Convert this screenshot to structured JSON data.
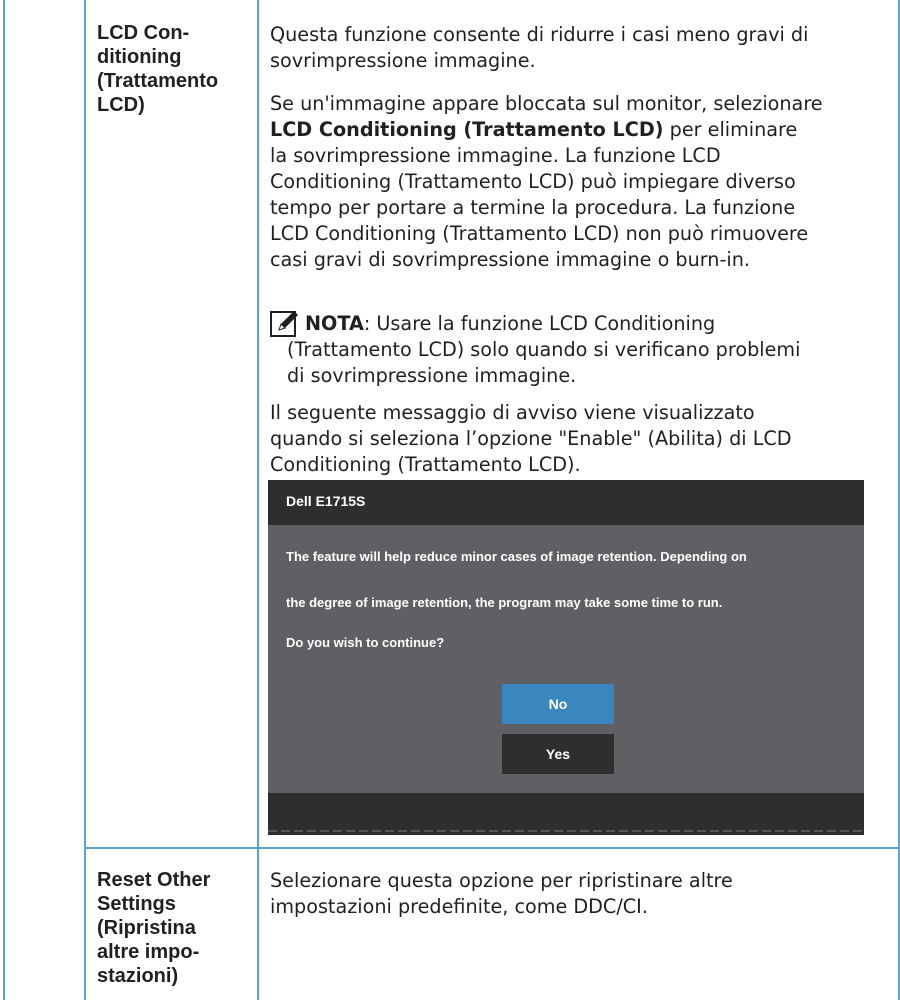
{
  "rows": [
    {
      "label_lines": [
        "LCD Con-",
        "ditioning",
        "(Trattamento",
        "LCD)"
      ],
      "paragraphs": {
        "p1_lines": [
          "Questa funzione consente di ridurre i casi meno gravi di",
          "sovrimpressione immagine."
        ],
        "p2_line1": "Se un'immagine appare bloccata sul monitor, selezionare",
        "p2_bold": "LCD Conditioning (Trattamento LCD)",
        "p2_after_bold": " per eliminare",
        "p2_rest": [
          "la sovrimpressione immagine. La funzione LCD",
          "Conditioning (Trattamento LCD) può impiegare diverso",
          "tempo per portare a termine la procedura. La funzione",
          "LCD Conditioning (Trattamento LCD) non può rimuovere",
          "casi gravi di sovrimpressione immagine o burn-in."
        ],
        "note_label": "NOTA",
        "note_line1": ": Usare la funzione LCD Conditioning",
        "note_rest": [
          "(Trattamento LCD) solo quando si verificano problemi",
          "di sovrimpressione immagine."
        ],
        "p3_lines": [
          "Il seguente messaggio di avviso viene visualizzato",
          "quando si seleziona l’opzione \"Enable\" (Abilita) di LCD",
          "Conditioning (Trattamento LCD)."
        ]
      }
    },
    {
      "label_lines": [
        "Reset Other",
        "Settings",
        "(Ripristina",
        "altre impo-",
        "stazioni)"
      ],
      "desc_lines": [
        "Selezionare questa opzione per ripristinare altre",
        "impostazioni predefinite, come DDC/CI."
      ]
    }
  ],
  "dialog": {
    "title": "Dell E1715S",
    "messages": [
      "The feature will help reduce minor cases of image retention. Depending on",
      "the degree of image retention, the program may take some time to run.",
      "Do you wish to continue?"
    ],
    "buttons": {
      "no": "No",
      "yes": "Yes"
    },
    "colors": {
      "bar": "#2e2e2e",
      "body": "#5e6063",
      "no_button": "#3a87c0",
      "yes_button": "#2e2e2e"
    }
  },
  "colors": {
    "rule": "#5aa3d0",
    "text": "#231f20"
  },
  "icons": {
    "note": "pencil-note-icon"
  }
}
